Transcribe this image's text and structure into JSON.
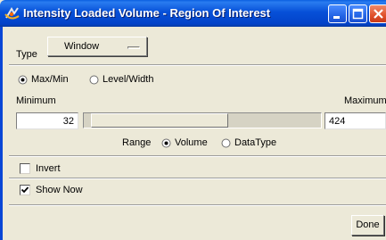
{
  "window": {
    "title": "Intensity Loaded Volume - Region Of Interest",
    "icon": "app-icon",
    "controls": [
      "minimize-icon",
      "maximize-icon",
      "close-icon"
    ]
  },
  "type_row": {
    "label": "Type",
    "selected": "Window"
  },
  "mode": {
    "options": [
      {
        "label": "Max/Min",
        "selected": true
      },
      {
        "label": "Level/Width",
        "selected": false
      }
    ]
  },
  "range": {
    "minimum_label": "Minimum",
    "maximum_label": "Maximum",
    "minimum_value": "32",
    "maximum_value": "424",
    "slider": {
      "low_fraction": 0.03,
      "high_fraction": 0.61
    },
    "scope_label": "Range",
    "scope_options": [
      {
        "label": "Volume",
        "selected": true
      },
      {
        "label": "DataType",
        "selected": false
      }
    ]
  },
  "options": {
    "invert": {
      "label": "Invert",
      "checked": false
    },
    "show_now": {
      "label": "Show Now",
      "checked": true
    }
  },
  "footer": {
    "done_label": "Done"
  }
}
